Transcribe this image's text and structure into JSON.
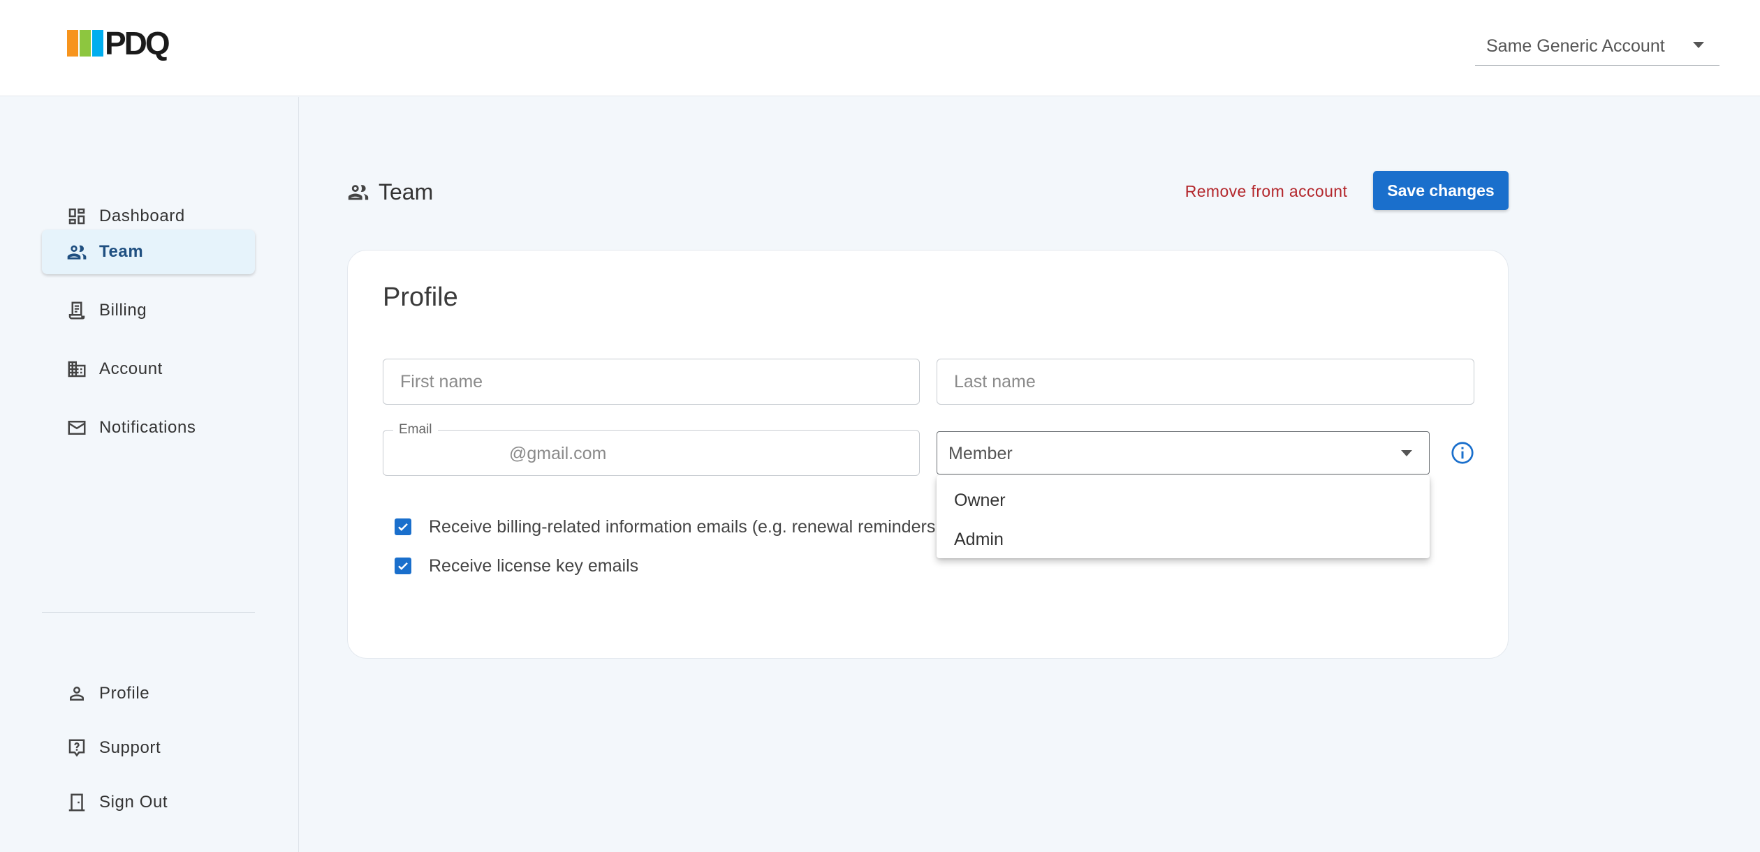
{
  "brand": {
    "logo_text": "PDQ",
    "logo_colors": [
      "#f7941d",
      "#8dc63f",
      "#00aeef",
      "#1a1a1a"
    ]
  },
  "topbar": {
    "account_selector": "Same Generic Account"
  },
  "sidebar": {
    "items": [
      {
        "label": "Dashboard",
        "icon": "dashboard-icon"
      },
      {
        "label": "Team",
        "icon": "team-icon",
        "active": true
      },
      {
        "label": "Billing",
        "icon": "billing-icon"
      },
      {
        "label": "Account",
        "icon": "building-icon"
      },
      {
        "label": "Notifications",
        "icon": "mail-icon"
      }
    ],
    "bottom_items": [
      {
        "label": "Profile",
        "icon": "person-icon"
      },
      {
        "label": "Support",
        "icon": "help-icon"
      },
      {
        "label": "Sign Out",
        "icon": "door-icon"
      }
    ]
  },
  "page": {
    "title": "Team",
    "remove_label": "Remove from account",
    "save_label": "Save changes"
  },
  "profile": {
    "title": "Profile",
    "first_name_placeholder": "First name",
    "last_name_placeholder": "Last name",
    "email_label": "Email",
    "email_value": "@gmail.com",
    "role_value": "Member",
    "role_options": [
      "Owner",
      "Admin"
    ],
    "checkboxes": [
      {
        "label": "Receive billing-related information emails (e.g. renewal reminders",
        "checked": true
      },
      {
        "label": "Receive license key emails",
        "checked": true
      }
    ]
  },
  "colors": {
    "primary": "#1a6fcc",
    "danger": "#b3262b",
    "active_nav_bg": "#e6f3fb",
    "page_bg": "#f3f7fb"
  }
}
